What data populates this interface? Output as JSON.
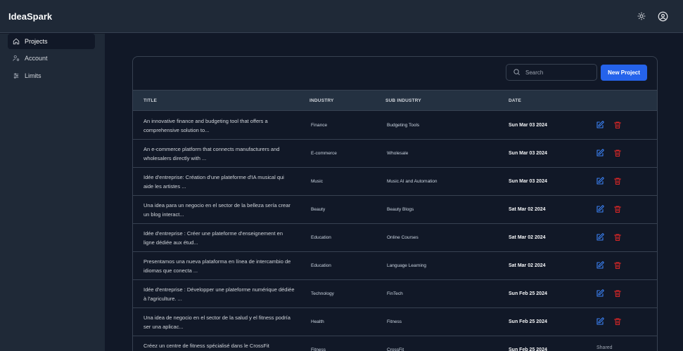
{
  "app": {
    "title": "IdeaSpark"
  },
  "header": {
    "theme_icon": "sun-icon",
    "profile_icon": "user-circle-icon"
  },
  "sidebar": {
    "items": [
      {
        "label": "Projects",
        "icon": "home-icon",
        "active": true
      },
      {
        "label": "Account",
        "icon": "user-settings-icon",
        "active": false
      },
      {
        "label": "Limits",
        "icon": "sliders-icon",
        "active": false
      }
    ]
  },
  "toolbar": {
    "search_placeholder": "Search",
    "new_project_label": "New Project"
  },
  "table": {
    "headers": {
      "title": "TITLE",
      "industry": "INDUSTRY",
      "sub_industry": "SUB INDUSTRY",
      "date": "DATE"
    },
    "rows": [
      {
        "title": "An innovative finance and budgeting tool that offers a comprehensive solution to...",
        "industry": "Finance",
        "sub_industry": "Budgeting Tools",
        "date": "Sun Mar 03 2024"
      },
      {
        "title": "An e-commerce platform that connects manufacturers and wholesalers directly with ...",
        "industry": "E-commerce",
        "sub_industry": "Wholesale",
        "date": "Sun Mar 03 2024"
      },
      {
        "title": "Idée d'entreprise: Création d'une plateforme d'IA musical qui aide les artistes ...",
        "industry": "Music",
        "sub_industry": "Music AI and Automation",
        "date": "Sun Mar 03 2024"
      },
      {
        "title": "Una idea para un negocio en el sector de la belleza sería crear un blog interact...",
        "industry": "Beauty",
        "sub_industry": "Beauty Blogs",
        "date": "Sat Mar 02 2024"
      },
      {
        "title": "Idée d'entreprise : Créer une plateforme d'enseignement en ligne dédiée aux étud...",
        "industry": "Education",
        "sub_industry": "Online Courses",
        "date": "Sat Mar 02 2024"
      },
      {
        "title": "Presentamos una nueva plataforma en línea de intercambio de idiomas que conecta ...",
        "industry": "Education",
        "sub_industry": "Language Learning",
        "date": "Sat Mar 02 2024"
      },
      {
        "title": "Idée d'entreprise : Développer une plateforme numérique dédiée à l'agriculture. ...",
        "industry": "Technology",
        "sub_industry": "FinTech",
        "date": "Sun Feb 25 2024"
      },
      {
        "title": "Una idea de negocio en el sector de la salud y el fitness podría ser una aplicac...",
        "industry": "Health",
        "sub_industry": "Fitness",
        "date": "Sun Feb 25 2024"
      },
      {
        "title": "Créez un centre de fitness spécialisé dans le CrossFit",
        "industry": "Fitness",
        "sub_industry": "CrossFit",
        "date": "Sun Feb 25 2024",
        "status": "Shared"
      }
    ]
  }
}
